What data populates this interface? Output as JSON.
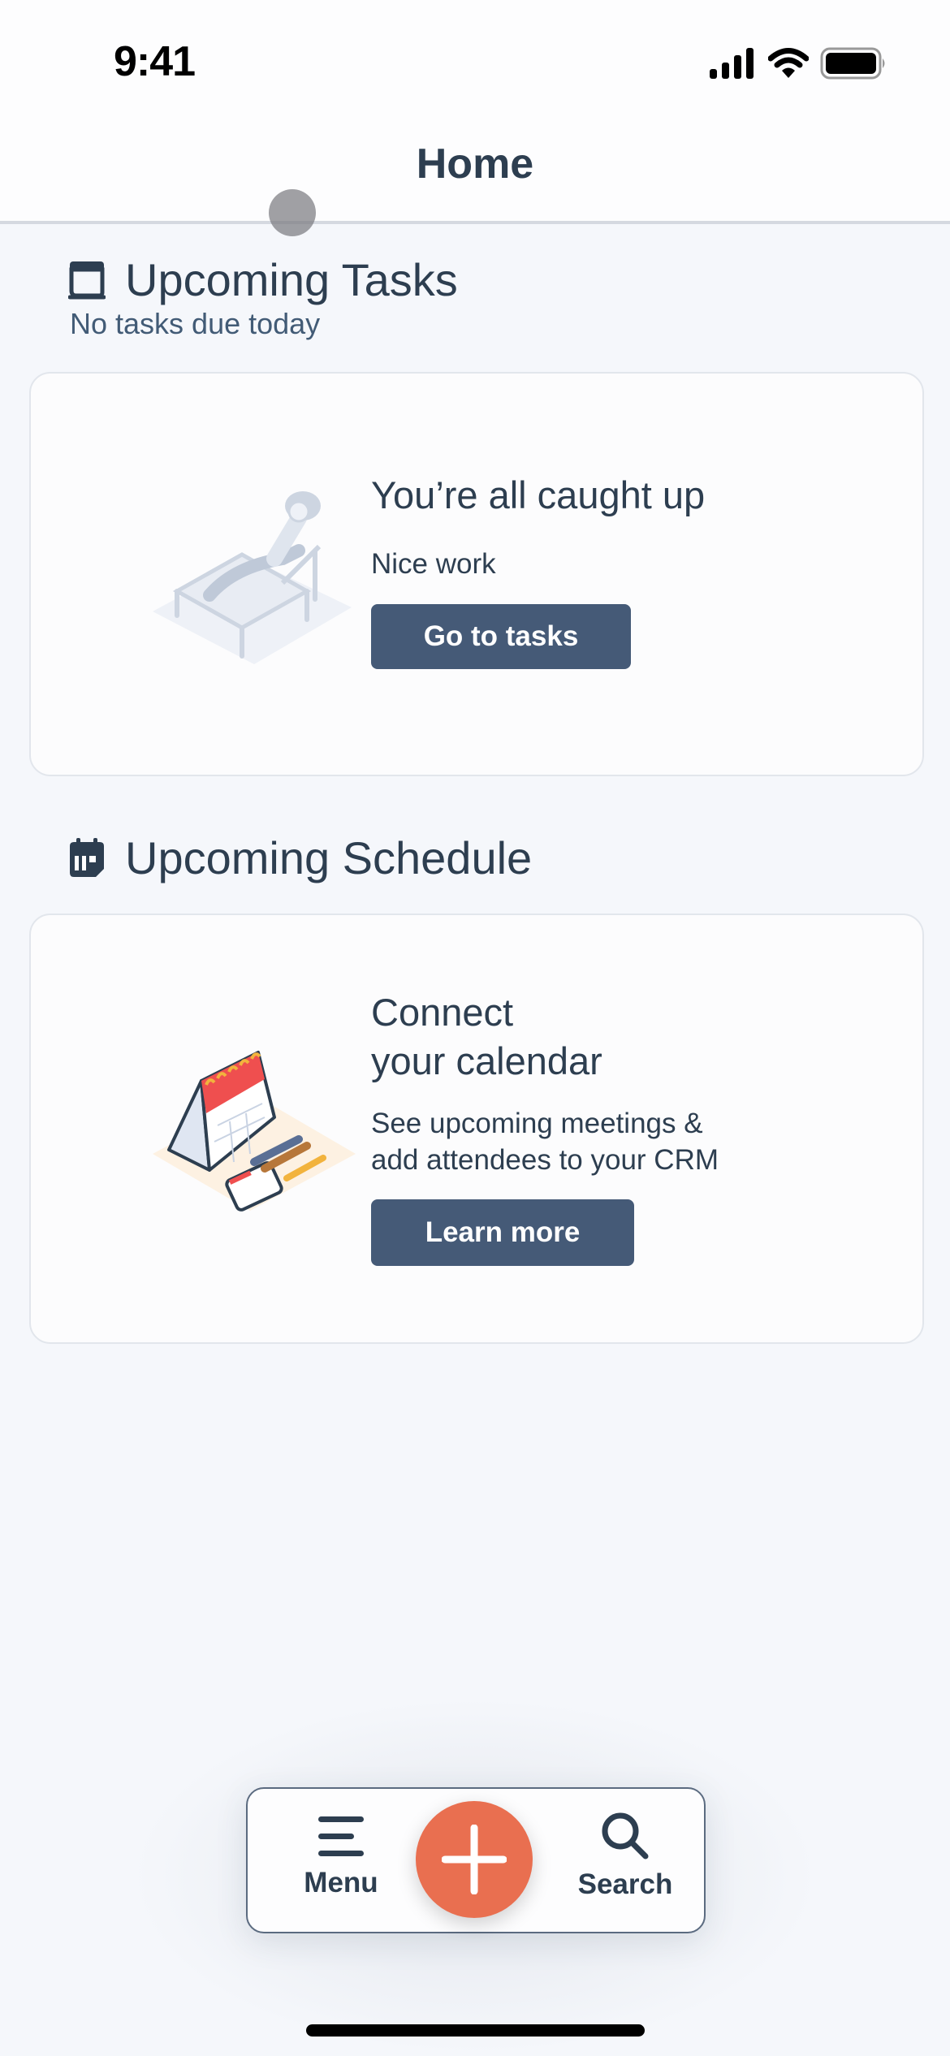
{
  "status_bar": {
    "time": "9:41",
    "icons": [
      "cellular-signal-icon",
      "wifi-icon",
      "battery-icon"
    ]
  },
  "header": {
    "title": "Home"
  },
  "tasks_section": {
    "icon": "task-book-icon",
    "title": "Upcoming Tasks",
    "subtitle": "No tasks due today",
    "card": {
      "illustration": "person-relaxing-chair-illustration",
      "title": "You’re all caught up",
      "body": "Nice work",
      "button_label": "Go to tasks"
    }
  },
  "schedule_section": {
    "icon": "calendar-icon",
    "title": "Upcoming Schedule",
    "card": {
      "illustration": "desk-calendar-illustration",
      "title_line1": "Connect",
      "title_line2": "your calendar",
      "body_line1": "See upcoming meetings &",
      "body_line2": "add attendees to your CRM",
      "button_label": "Learn more"
    }
  },
  "tab_bar": {
    "menu_label": "Menu",
    "menu_icon": "hamburger-menu-icon",
    "add_icon": "plus-icon",
    "search_label": "Search",
    "search_icon": "search-icon"
  },
  "colors": {
    "primary_text": "#2d3e50",
    "secondary_text": "#425b76",
    "button_bg": "#455a77",
    "fab_bg": "#e96f50",
    "page_bg": "#f5f7fb"
  }
}
